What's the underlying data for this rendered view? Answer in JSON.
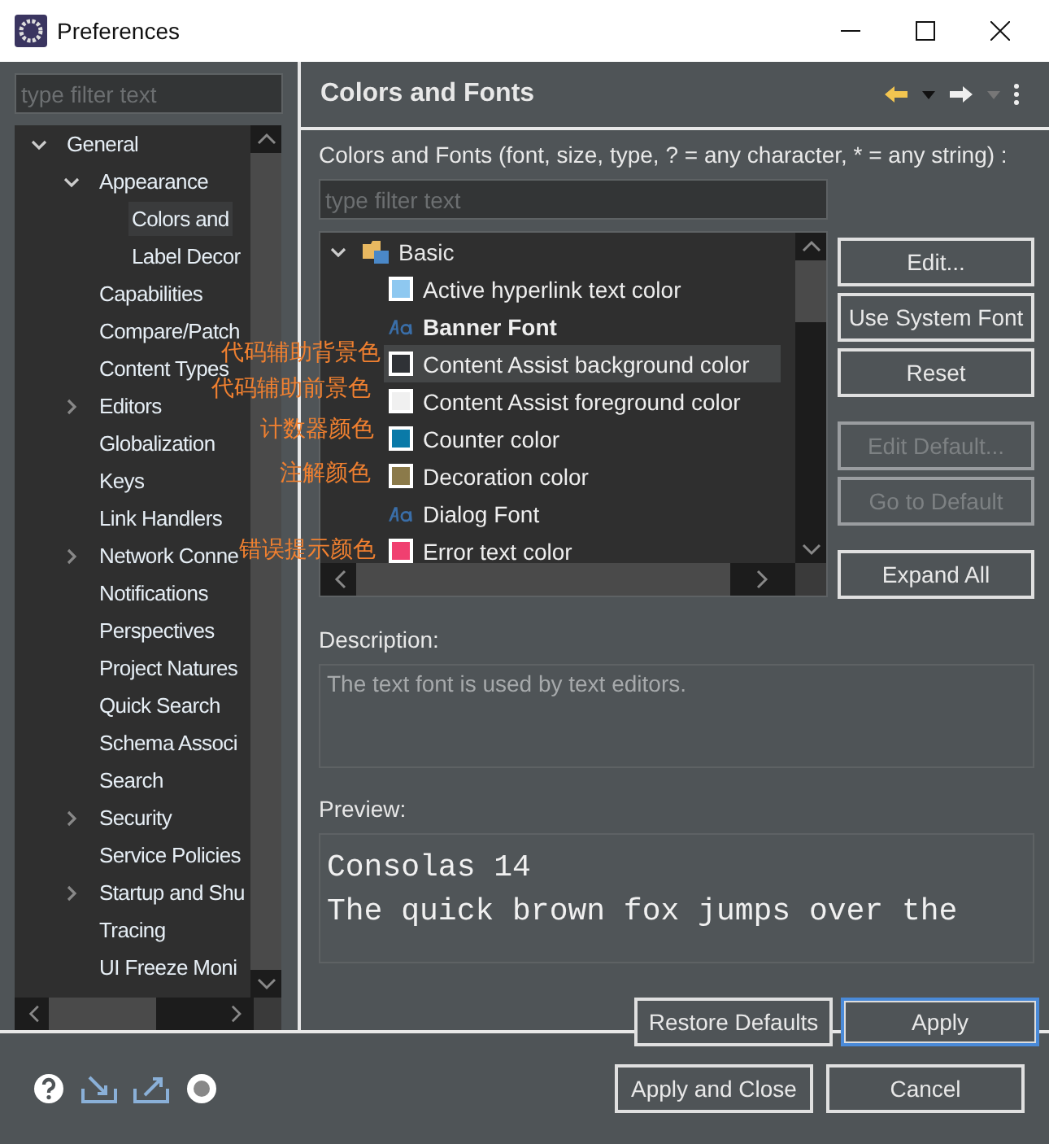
{
  "window": {
    "title": "Preferences"
  },
  "sidebar": {
    "filter": {
      "placeholder": "type filter text"
    },
    "tree": [
      {
        "label": "General",
        "expanded": true,
        "selected": false,
        "children": [
          {
            "label": "Appearance",
            "expanded": true,
            "selected": false,
            "children": [
              {
                "label": "Colors and",
                "selected": true
              },
              {
                "label": "Label Decor",
                "selected": false
              }
            ]
          },
          {
            "label": "Capabilities",
            "selected": false
          },
          {
            "label": "Compare/Patch",
            "selected": false
          },
          {
            "label": "Content Types",
            "selected": false
          },
          {
            "label": "Editors",
            "expanded": false,
            "selected": false
          },
          {
            "label": "Globalization",
            "selected": false
          },
          {
            "label": "Keys",
            "selected": false
          },
          {
            "label": "Link Handlers",
            "selected": false
          },
          {
            "label": "Network Conne",
            "expanded": false,
            "selected": false
          },
          {
            "label": "Notifications",
            "selected": false
          },
          {
            "label": "Perspectives",
            "selected": false
          },
          {
            "label": "Project Natures",
            "selected": false
          },
          {
            "label": "Quick Search",
            "selected": false
          },
          {
            "label": "Schema Associ",
            "selected": false
          },
          {
            "label": "Search",
            "selected": false
          },
          {
            "label": "Security",
            "expanded": false,
            "selected": false
          },
          {
            "label": "Service Policies",
            "selected": false
          },
          {
            "label": "Startup and Shu",
            "expanded": false,
            "selected": false
          },
          {
            "label": "Tracing",
            "selected": false
          },
          {
            "label": "UI Freeze Moni",
            "selected": false
          }
        ]
      }
    ]
  },
  "page": {
    "title": "Colors and Fonts",
    "filter_label": "Colors and Fonts (font, size, type, ? = any character, * = any string) :",
    "filter": {
      "placeholder": "type filter text"
    },
    "category": {
      "label": "Basic",
      "expanded": true
    },
    "items": [
      {
        "kind": "color",
        "label": "Active hyperlink text color",
        "color": "#8ec8f0",
        "selected": false
      },
      {
        "kind": "font",
        "label": "Banner Font",
        "bold": true,
        "selected": false
      },
      {
        "kind": "color",
        "label": "Content Assist background color",
        "color": "#2f3236",
        "selected": true
      },
      {
        "kind": "color",
        "label": "Content Assist foreground color",
        "color": "#f0f0f0",
        "selected": false
      },
      {
        "kind": "color",
        "label": "Counter color",
        "color": "#0a7aa8",
        "selected": false
      },
      {
        "kind": "color",
        "label": "Decoration color",
        "color": "#8b7a4a",
        "selected": false
      },
      {
        "kind": "font",
        "label": "Dialog Font",
        "bold": false,
        "selected": false
      },
      {
        "kind": "color",
        "label": "Error text color",
        "color": "#f04070",
        "selected": false
      }
    ],
    "buttons": [
      {
        "label": "Edit...",
        "disabled": false
      },
      {
        "label": "Use System Font",
        "disabled": false
      },
      {
        "label": "Reset",
        "disabled": false
      },
      {
        "label": "Edit Default...",
        "disabled": true
      },
      {
        "label": "Go to Default",
        "disabled": true
      },
      {
        "label": "Expand All",
        "disabled": false
      }
    ],
    "description_label": "Description:",
    "description": "The text font is used by text editors.",
    "preview_label": "Preview:",
    "preview": [
      "Consolas 14",
      "The quick brown fox jumps over the"
    ],
    "actions": [
      {
        "label": "Restore Defaults",
        "default": false
      },
      {
        "label": "Apply",
        "default": true
      }
    ]
  },
  "annotations": [
    {
      "text": "代码辅助背景色"
    },
    {
      "text": "代码辅助前景色"
    },
    {
      "text": "计数器颜色"
    },
    {
      "text": "注解颜色"
    },
    {
      "text": "错误提示颜色"
    }
  ],
  "footer": {
    "buttons": [
      {
        "label": "Apply and Close"
      },
      {
        "label": "Cancel"
      }
    ]
  }
}
